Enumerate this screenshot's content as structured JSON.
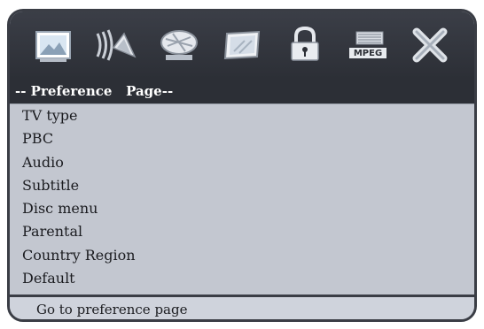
{
  "toolbar": {
    "icons": [
      {
        "name": "picture-icon"
      },
      {
        "name": "speaker-audio-icon"
      },
      {
        "name": "satellite-dish-icon"
      },
      {
        "name": "video-display-icon"
      },
      {
        "name": "padlock-icon"
      },
      {
        "name": "mpeg-icon",
        "label": "MPEG"
      },
      {
        "name": "close-x-icon"
      }
    ]
  },
  "header": {
    "title": "-- Preference   Page--"
  },
  "menu": {
    "items": [
      {
        "label": "TV type"
      },
      {
        "label": "PBC"
      },
      {
        "label": "Audio"
      },
      {
        "label": "Subtitle"
      },
      {
        "label": "Disc menu"
      },
      {
        "label": "Parental"
      },
      {
        "label": "Country Region"
      },
      {
        "label": "Default"
      }
    ]
  },
  "status": {
    "text": "Go to preference page"
  },
  "colors": {
    "toolbar_bg": "#2c2f36",
    "panel_bg": "#c3c7d0",
    "text": "#1b1c20"
  }
}
